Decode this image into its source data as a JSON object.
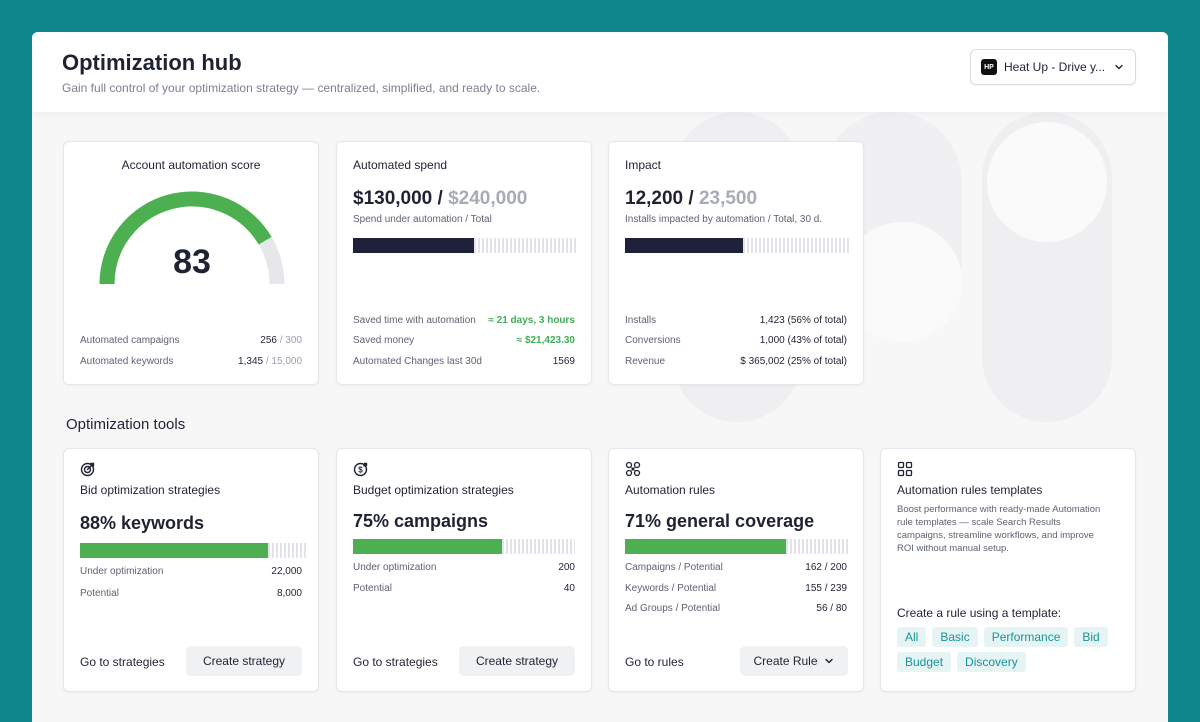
{
  "header": {
    "title": "Optimization hub",
    "subtitle": "Gain full control of your optimization strategy — centralized, simplified, and ready to scale.",
    "app_select": {
      "logo_text": "HP",
      "value": "Heat Up - Drive y...",
      "icon": "chevron-down-icon"
    }
  },
  "score_card": {
    "title": "Account automation score",
    "score": "83",
    "score_fraction": 0.83,
    "rows": [
      {
        "label": "Automated campaigns",
        "value": "256",
        "total": " / 300"
      },
      {
        "label": "Automated keywords",
        "value": "1,345",
        "total": " / 15,000"
      }
    ]
  },
  "spend_card": {
    "title": "Automated spend",
    "value": "$130,000 /",
    "total": " $240,000",
    "caption": "Spend under automation / Total",
    "progress": 0.54,
    "rows": [
      {
        "label": "Saved time with automation",
        "value": "≈ 21 days, 3 hours"
      },
      {
        "label": "Saved money",
        "value": "≈ $21,423.30"
      },
      {
        "label": "Automated Changes last 30d",
        "value": "1569"
      }
    ]
  },
  "impact_card": {
    "title": "Impact",
    "value": "12,200 /",
    "total": " 23,500",
    "caption": "Installs impacted by automation / Total, 30 d.",
    "progress": 0.52,
    "rows": [
      {
        "label": "Installs",
        "value": "1,423 (56% of total)"
      },
      {
        "label": "Conversions",
        "value": "1,000 (43% of total)"
      },
      {
        "label": "Revenue",
        "value": "$ 365,002 (25% of total)"
      }
    ]
  },
  "tools": {
    "section_title": "Optimization tools",
    "bid": {
      "icon": "target-icon",
      "title": "Bid optimization strategies",
      "headline": "88% keywords",
      "progress": 0.83,
      "rows": [
        {
          "label": "Under optimization",
          "value": "22,000"
        },
        {
          "label": "Potential",
          "value": "8,000"
        }
      ],
      "link": "Go to strategies",
      "button": "Create strategy"
    },
    "budget": {
      "icon": "budget-target-icon",
      "title": "Budget optimization strategies",
      "headline": "75% campaigns",
      "progress": 0.67,
      "rows": [
        {
          "label": "Under optimization",
          "value": "200"
        },
        {
          "label": "Potential",
          "value": "40"
        }
      ],
      "link": "Go to strategies",
      "button": "Create strategy"
    },
    "rules": {
      "icon": "rules-icon",
      "title": "Automation rules",
      "headline": "71% general coverage",
      "progress": 0.72,
      "rows": [
        {
          "label": "Campaigns / Potential",
          "value": "162 / 200"
        },
        {
          "label": "Keywords / Potential",
          "value": "155 / 239"
        },
        {
          "label": "Ad Groups / Potential",
          "value": "56 / 80"
        }
      ],
      "link": "Go to rules",
      "button": "Create Rule"
    },
    "templates": {
      "icon": "grid-icon",
      "title": "Automation rules templates",
      "description": "Boost performance with ready-made Automation rule templates — scale Search Results campaigns, streamline workflows, and improve ROI without manual setup.",
      "create_label": "Create a rule using a template:",
      "tags": [
        "All",
        "Basic",
        "Performance",
        "Bid",
        "Budget",
        "Discovery"
      ]
    }
  },
  "colors": {
    "green": "#4caf50",
    "navy": "#1e2139",
    "teal": "#0f878a",
    "tag_text": "#16939a"
  }
}
